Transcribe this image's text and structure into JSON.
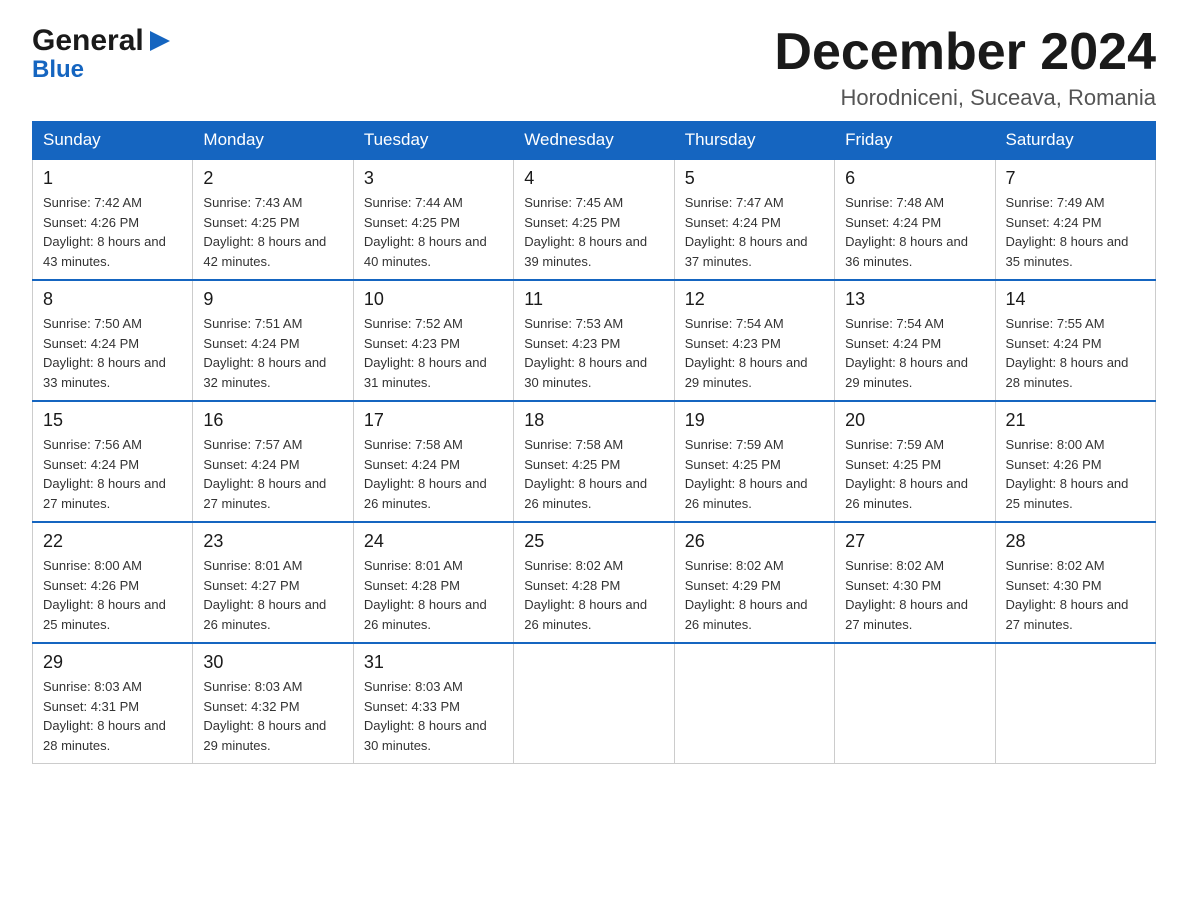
{
  "logo": {
    "general": "General",
    "blue": "Blue",
    "triangle": "▶"
  },
  "title": "December 2024",
  "subtitle": "Horodniceni, Suceava, Romania",
  "days_of_week": [
    "Sunday",
    "Monday",
    "Tuesday",
    "Wednesday",
    "Thursday",
    "Friday",
    "Saturday"
  ],
  "weeks": [
    [
      {
        "day": "1",
        "sunrise": "7:42 AM",
        "sunset": "4:26 PM",
        "daylight": "8 hours and 43 minutes."
      },
      {
        "day": "2",
        "sunrise": "7:43 AM",
        "sunset": "4:25 PM",
        "daylight": "8 hours and 42 minutes."
      },
      {
        "day": "3",
        "sunrise": "7:44 AM",
        "sunset": "4:25 PM",
        "daylight": "8 hours and 40 minutes."
      },
      {
        "day": "4",
        "sunrise": "7:45 AM",
        "sunset": "4:25 PM",
        "daylight": "8 hours and 39 minutes."
      },
      {
        "day": "5",
        "sunrise": "7:47 AM",
        "sunset": "4:24 PM",
        "daylight": "8 hours and 37 minutes."
      },
      {
        "day": "6",
        "sunrise": "7:48 AM",
        "sunset": "4:24 PM",
        "daylight": "8 hours and 36 minutes."
      },
      {
        "day": "7",
        "sunrise": "7:49 AM",
        "sunset": "4:24 PM",
        "daylight": "8 hours and 35 minutes."
      }
    ],
    [
      {
        "day": "8",
        "sunrise": "7:50 AM",
        "sunset": "4:24 PM",
        "daylight": "8 hours and 33 minutes."
      },
      {
        "day": "9",
        "sunrise": "7:51 AM",
        "sunset": "4:24 PM",
        "daylight": "8 hours and 32 minutes."
      },
      {
        "day": "10",
        "sunrise": "7:52 AM",
        "sunset": "4:23 PM",
        "daylight": "8 hours and 31 minutes."
      },
      {
        "day": "11",
        "sunrise": "7:53 AM",
        "sunset": "4:23 PM",
        "daylight": "8 hours and 30 minutes."
      },
      {
        "day": "12",
        "sunrise": "7:54 AM",
        "sunset": "4:23 PM",
        "daylight": "8 hours and 29 minutes."
      },
      {
        "day": "13",
        "sunrise": "7:54 AM",
        "sunset": "4:24 PM",
        "daylight": "8 hours and 29 minutes."
      },
      {
        "day": "14",
        "sunrise": "7:55 AM",
        "sunset": "4:24 PM",
        "daylight": "8 hours and 28 minutes."
      }
    ],
    [
      {
        "day": "15",
        "sunrise": "7:56 AM",
        "sunset": "4:24 PM",
        "daylight": "8 hours and 27 minutes."
      },
      {
        "day": "16",
        "sunrise": "7:57 AM",
        "sunset": "4:24 PM",
        "daylight": "8 hours and 27 minutes."
      },
      {
        "day": "17",
        "sunrise": "7:58 AM",
        "sunset": "4:24 PM",
        "daylight": "8 hours and 26 minutes."
      },
      {
        "day": "18",
        "sunrise": "7:58 AM",
        "sunset": "4:25 PM",
        "daylight": "8 hours and 26 minutes."
      },
      {
        "day": "19",
        "sunrise": "7:59 AM",
        "sunset": "4:25 PM",
        "daylight": "8 hours and 26 minutes."
      },
      {
        "day": "20",
        "sunrise": "7:59 AM",
        "sunset": "4:25 PM",
        "daylight": "8 hours and 26 minutes."
      },
      {
        "day": "21",
        "sunrise": "8:00 AM",
        "sunset": "4:26 PM",
        "daylight": "8 hours and 25 minutes."
      }
    ],
    [
      {
        "day": "22",
        "sunrise": "8:00 AM",
        "sunset": "4:26 PM",
        "daylight": "8 hours and 25 minutes."
      },
      {
        "day": "23",
        "sunrise": "8:01 AM",
        "sunset": "4:27 PM",
        "daylight": "8 hours and 26 minutes."
      },
      {
        "day": "24",
        "sunrise": "8:01 AM",
        "sunset": "4:28 PM",
        "daylight": "8 hours and 26 minutes."
      },
      {
        "day": "25",
        "sunrise": "8:02 AM",
        "sunset": "4:28 PM",
        "daylight": "8 hours and 26 minutes."
      },
      {
        "day": "26",
        "sunrise": "8:02 AM",
        "sunset": "4:29 PM",
        "daylight": "8 hours and 26 minutes."
      },
      {
        "day": "27",
        "sunrise": "8:02 AM",
        "sunset": "4:30 PM",
        "daylight": "8 hours and 27 minutes."
      },
      {
        "day": "28",
        "sunrise": "8:02 AM",
        "sunset": "4:30 PM",
        "daylight": "8 hours and 27 minutes."
      }
    ],
    [
      {
        "day": "29",
        "sunrise": "8:03 AM",
        "sunset": "4:31 PM",
        "daylight": "8 hours and 28 minutes."
      },
      {
        "day": "30",
        "sunrise": "8:03 AM",
        "sunset": "4:32 PM",
        "daylight": "8 hours and 29 minutes."
      },
      {
        "day": "31",
        "sunrise": "8:03 AM",
        "sunset": "4:33 PM",
        "daylight": "8 hours and 30 minutes."
      },
      null,
      null,
      null,
      null
    ]
  ]
}
